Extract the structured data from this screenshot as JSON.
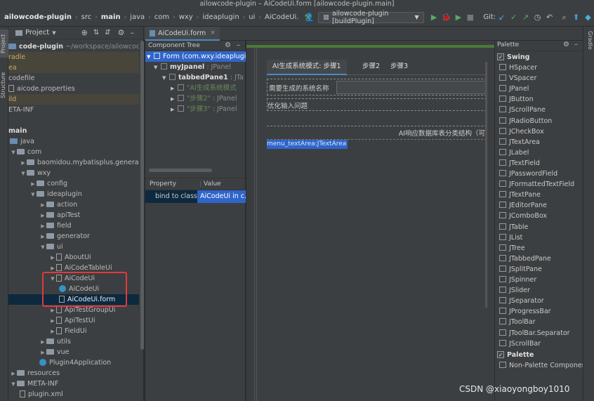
{
  "window": {
    "title": "ailowcode-plugin – AiCodeUi.form [ailowcode-plugin.main]"
  },
  "breadcrumb": [
    "ailowcode-plugin",
    "src",
    "main",
    "java",
    "com",
    "wxy",
    "ideaplugin",
    "ui",
    "AiCodeUi."
  ],
  "toolbar": {
    "run_config": "ailowcode-plugin [buildPlugin]",
    "git_label": "Git:"
  },
  "left_strip": {
    "project_tab": "Project",
    "structure_tab": "Structure"
  },
  "right_strip": {
    "gradle_tab": "Gradle"
  },
  "project_panel": {
    "header": "Project",
    "rows": [
      {
        "text": "code-plugin",
        "extra": " ~/workspace/ailowcode/ailo",
        "style": "bold"
      },
      {
        "text": "radle",
        "style": "orange"
      },
      {
        "text": "ea",
        "style": "orange"
      },
      {
        "text": "codefile",
        "style": "plain"
      },
      {
        "text": "aicode.properties",
        "style": "plain"
      },
      {
        "text": "ild",
        "style": "orange"
      },
      {
        "text": "ETA-INF",
        "style": "plain"
      },
      {
        "text": "",
        "style": "plain"
      },
      {
        "text": "main",
        "style": "bold"
      },
      {
        "text": "java",
        "style": "plain"
      },
      {
        "text": "com",
        "style": "plain"
      },
      {
        "text": "baomidou.mybatisplus.generato",
        "style": "plain"
      },
      {
        "text": "wxy",
        "style": "plain"
      },
      {
        "text": "config",
        "style": "plain"
      },
      {
        "text": "ideaplugin",
        "style": "plain"
      },
      {
        "text": "action",
        "style": "plain"
      },
      {
        "text": "apiTest",
        "style": "plain"
      },
      {
        "text": "field",
        "style": "plain"
      },
      {
        "text": "generator",
        "style": "plain"
      },
      {
        "text": "ui",
        "style": "plain"
      },
      {
        "text": "AboutUi",
        "style": "plain"
      },
      {
        "text": "AiCodeTableUi",
        "style": "plain"
      },
      {
        "text": "AiCodeUi",
        "style": "plain"
      },
      {
        "text": "AiCodeUi",
        "style": "plain"
      },
      {
        "text": "AiCodeUi.form",
        "style": "plain"
      },
      {
        "text": "ApiTestGroupUi",
        "style": "plain"
      },
      {
        "text": "ApiTestUi",
        "style": "plain"
      },
      {
        "text": "FieldUi",
        "style": "plain"
      },
      {
        "text": "utils",
        "style": "plain"
      },
      {
        "text": "vue",
        "style": "plain"
      },
      {
        "text": "Plugin4Application",
        "style": "plain"
      },
      {
        "text": "resources",
        "style": "plain"
      },
      {
        "text": "META-INF",
        "style": "plain"
      },
      {
        "text": "plugin.xml",
        "style": "plain"
      }
    ]
  },
  "editor_tab": {
    "label": "AiCodeUi.form"
  },
  "component_tree": {
    "title": "Component Tree",
    "rows": [
      {
        "name": "Form (com.wxy.ideaplugi",
        "type": ""
      },
      {
        "name": "myJpanel",
        "type": " : JPanel"
      },
      {
        "name": "tabbedPane1",
        "type": " : JTa"
      },
      {
        "name": "\"AI生成系统模式",
        "type": ""
      },
      {
        "name": "\"步骤2\"",
        "type": " : JPanel"
      },
      {
        "name": "\"步骤3\"",
        "type": " : JPanel"
      }
    ]
  },
  "property_panel": {
    "col_property": "Property",
    "col_value": "Value",
    "row_property": "bind to class",
    "row_value": "AiCodeUi in c..."
  },
  "design": {
    "tabs": [
      "AI生成系统模式: 步骤1",
      "步骤2",
      "步骤3"
    ],
    "system_name_label": "需要生成的系统名称",
    "optimize_label": "优化输入问题",
    "ai_response_label": "AI响应数据库表分类结构（可",
    "textarea_label": "menu_textArea:JTextArea"
  },
  "palette": {
    "title": "Palette",
    "group1": "Swing",
    "items": [
      "HSpacer",
      "VSpacer",
      "JPanel",
      "JButton",
      "JScrollPane",
      "JRadioButton",
      "JCheckBox",
      "JTextArea",
      "JLabel",
      "JTextField",
      "JPasswordField",
      "JFormattedTextField",
      "JTextPane",
      "JEditorPane",
      "JComboBox",
      "JTable",
      "JList",
      "JTree",
      "JTabbedPane",
      "JSplitPane",
      "JSpinner",
      "JSlider",
      "JSeparator",
      "JProgressBar",
      "JToolBar",
      "JToolBar.Separator",
      "JScrollBar"
    ],
    "group2": "Palette",
    "group2_item": "Non-Palette Component..."
  },
  "watermark": "CSDN @xiaoyongboy1010",
  "colors": {
    "accent": "#4a88c7",
    "selection": "#2f65ca",
    "highlight_box": "#e0393e"
  }
}
